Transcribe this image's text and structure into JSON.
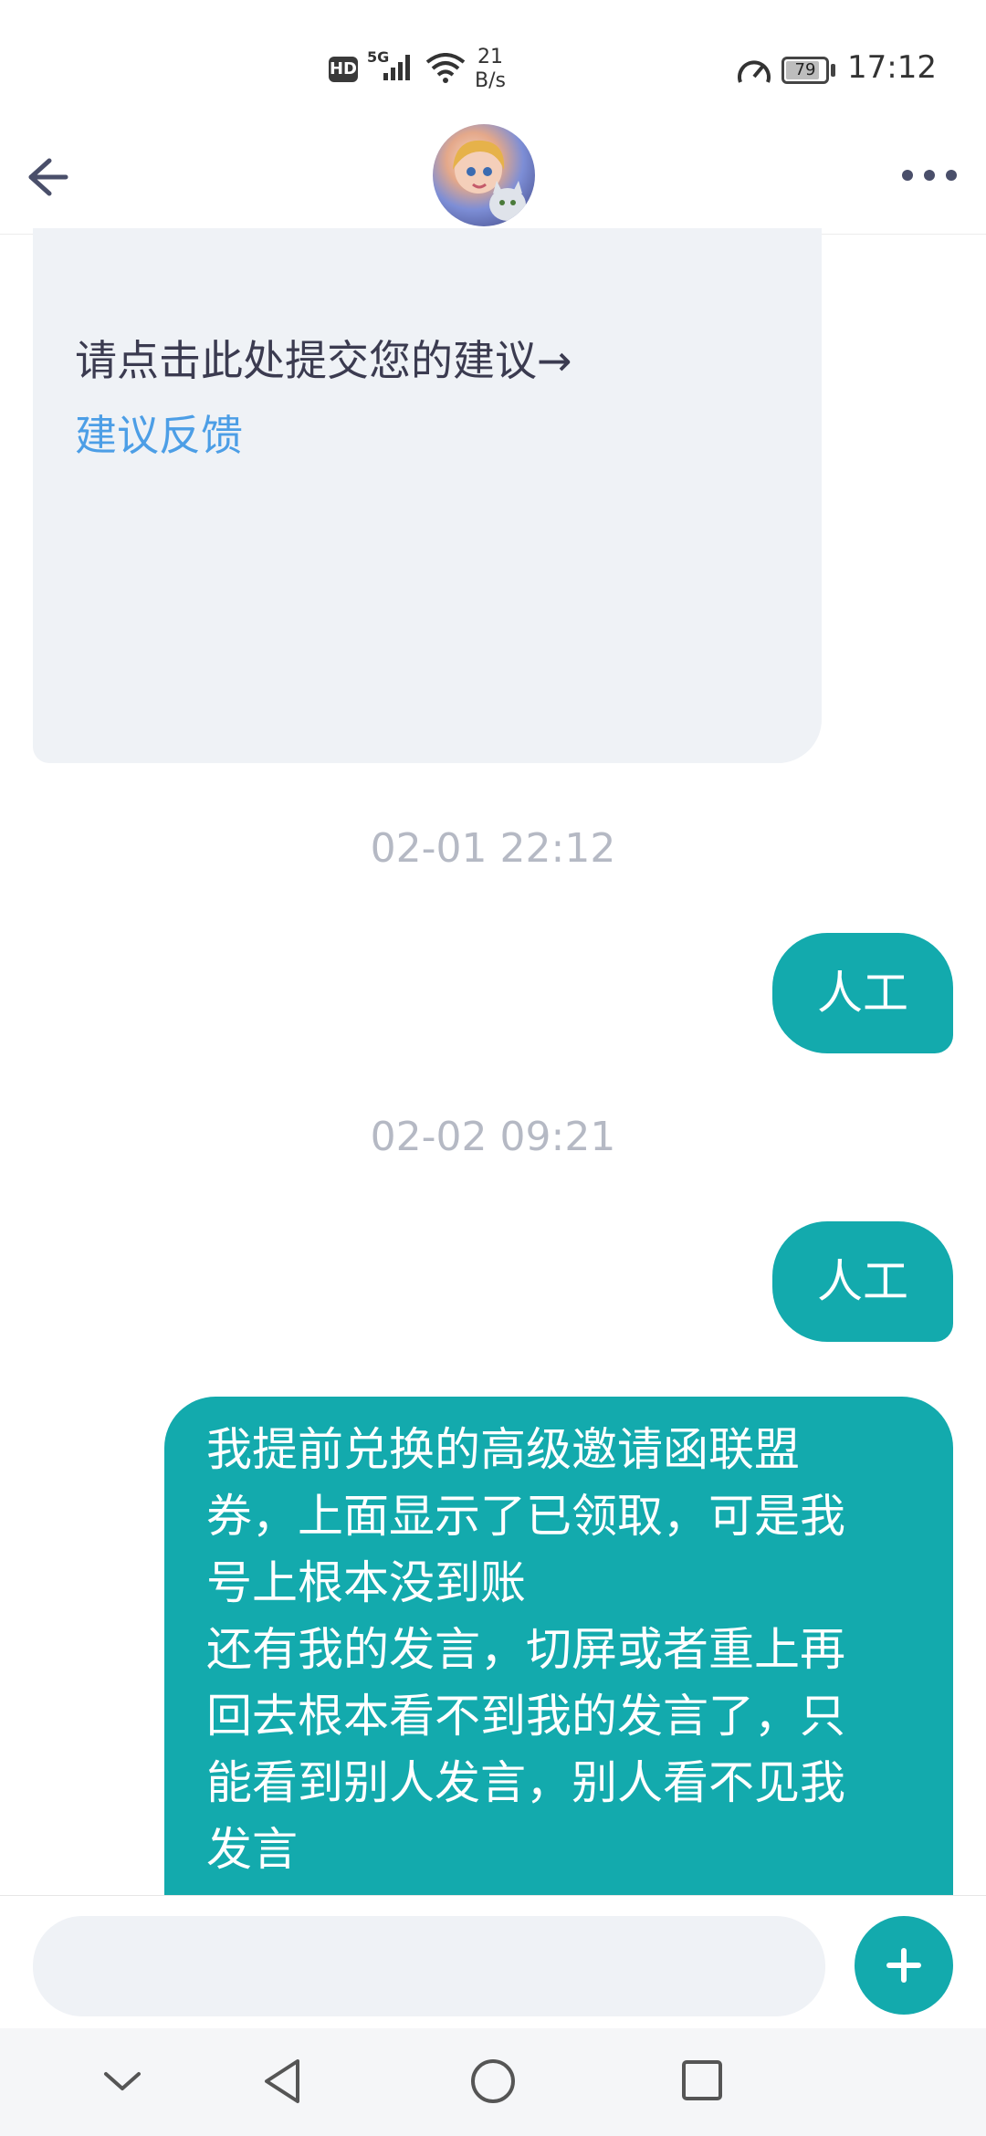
{
  "status_bar": {
    "hd_badge": "HD",
    "network": "5G",
    "data_rate_value": "21",
    "data_rate_unit": "B/s",
    "battery": "79",
    "time": "17:12"
  },
  "header": {
    "back_icon": "arrow-left-icon",
    "avatar_icon": "bot-avatar",
    "more_icon": "more-dots-icon"
  },
  "messages": {
    "bot_text": "请点击此处提交您的建议→",
    "bot_link": "建议反馈",
    "timestamp_1": "02-01 22:12",
    "user_msg_1": "人工",
    "timestamp_2": "02-02 09:21",
    "user_msg_2": "人工",
    "user_msg_3_lines": [
      "我提前兑换的高级邀请函联盟",
      "券，上面显示了已领取，可是我",
      "号上根本没到账",
      "还有我的发言，切屏或者重上再",
      "回去根本看不到我的发言了，只",
      "能看到别人发言，别人看不见我",
      "发言"
    ]
  },
  "input_bar": {
    "placeholder": "",
    "plus_icon": "plus-icon"
  },
  "nav_bar": {
    "icons": [
      "chevron-down-icon",
      "back-triangle-icon",
      "home-circle-icon",
      "recents-square-icon"
    ]
  },
  "colors": {
    "accent": "#13aaad",
    "link": "#4c9ee6",
    "bot_bubble": "#eff2f6",
    "timestamp": "#b5b9c4"
  }
}
